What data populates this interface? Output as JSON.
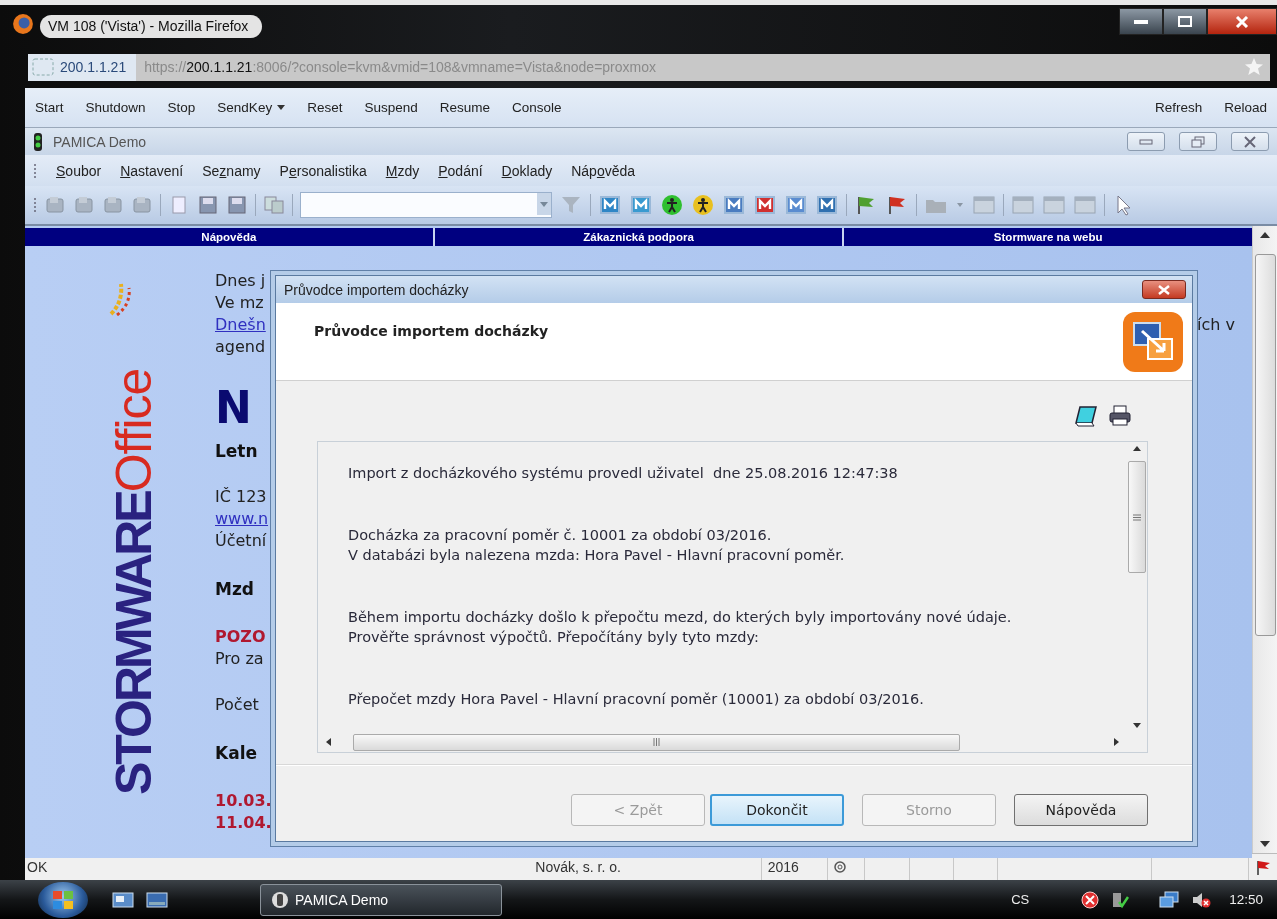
{
  "browser": {
    "title": "VM 108 ('Vista') - Mozilla Firefox",
    "site_identity": "200.1.1.21",
    "url": {
      "scheme": "https://",
      "host": "200.1.1.21",
      "rest": ":8006/?console=kvm&vmid=108&vmname=Vista&node=proxmox"
    }
  },
  "console_toolbar": {
    "left": [
      {
        "label": "Start",
        "has_menu": false
      },
      {
        "label": "Shutdown",
        "has_menu": false
      },
      {
        "label": "Stop",
        "has_menu": false
      },
      {
        "label": "SendKey",
        "has_menu": true
      },
      {
        "label": "Reset",
        "has_menu": false
      },
      {
        "label": "Suspend",
        "has_menu": false
      },
      {
        "label": "Resume",
        "has_menu": false
      },
      {
        "label": "Console",
        "has_menu": false
      }
    ],
    "right": [
      {
        "label": "Refresh",
        "has_menu": false
      },
      {
        "label": "Reload",
        "has_menu": false
      }
    ]
  },
  "app": {
    "title": "PAMICA Demo"
  },
  "menu": [
    {
      "key": "S",
      "rest": "oubor"
    },
    {
      "key": "N",
      "rest": "astavení"
    },
    {
      "lead": "Se",
      "key": "z",
      "rest": "namy"
    },
    {
      "lead": "P",
      "key": "e",
      "rest": "rsonalistika"
    },
    {
      "key": "M",
      "rest": "zdy"
    },
    {
      "key": "P",
      "rest": "odání"
    },
    {
      "key": "D",
      "rest": "oklady"
    },
    {
      "lead": "Náp",
      "key": "o",
      "rest": "věda"
    }
  ],
  "page": {
    "nav_links": [
      "Nápověda",
      "Zákaznická podpora",
      "Stormware na webu"
    ],
    "logo": {
      "brand": "STORMWARE",
      "product": "Office"
    },
    "blocks": [
      {
        "lines": [
          {
            "kind": "text",
            "text": "Dnes j"
          },
          {
            "kind": "text",
            "text": "Ve mz"
          },
          {
            "kind": "link",
            "text": "Dnešn"
          },
          {
            "kind": "text",
            "text": "agend"
          }
        ]
      },
      {
        "lines": [
          {
            "kind": "title",
            "text": "N"
          },
          {
            "kind": "subtitle",
            "text": "Letn"
          }
        ]
      },
      {
        "lines": [
          {
            "kind": "text",
            "text": "IČ 123"
          },
          {
            "kind": "link",
            "text": "www.n"
          },
          {
            "kind": "text",
            "text": "Účetní"
          }
        ]
      },
      {
        "lines": [
          {
            "kind": "heading",
            "text": "Mzd"
          }
        ]
      },
      {
        "lines": [
          {
            "kind": "alert",
            "text": "POZO"
          },
          {
            "kind": "text",
            "text": "Pro za"
          }
        ]
      },
      {
        "lines": [
          {
            "kind": "text",
            "text": "Počet"
          }
        ]
      },
      {
        "lines": [
          {
            "kind": "heading",
            "text": "Kale"
          }
        ]
      },
      {
        "lines": [
          {
            "kind": "date",
            "text": "10.03."
          },
          {
            "kind": "date",
            "text": "11.04."
          }
        ]
      }
    ],
    "side_fragment": "ích v"
  },
  "dialog": {
    "title": "Průvodce importem docházky",
    "header_title": "Průvodce importem docházky",
    "paragraphs": [
      [
        "Import z docházkového systému provedl uživatel  dne 25.08.2016 12:47:38"
      ],
      [
        "Docházka za pracovní poměr č. 10001 za období 03/2016.",
        "V databázi byla nalezena mzda: Hora Pavel - Hlavní pracovní poměr."
      ],
      [
        "Během importu docházky došlo k přepočtu mezd, do kterých byly importovány nové údaje.",
        "Prověřte správnost výpočtů. Přepočítány byly tyto mzdy:"
      ],
      [
        "Přepočet mzdy Hora Pavel - Hlavní pracovní poměr (10001) za období 03/2016."
      ]
    ],
    "buttons": [
      {
        "label": "< Zpět",
        "disabled": true,
        "default": false
      },
      {
        "label": "Dokončit",
        "disabled": false,
        "default": true
      },
      {
        "label": "Storno",
        "disabled": true,
        "default": false
      },
      {
        "label": "Nápověda",
        "disabled": false,
        "default": false
      }
    ]
  },
  "status_bar": {
    "message": "OK",
    "company": "Novák, s. r. o.",
    "year": "2016"
  },
  "taskbar": {
    "tasks": [
      {
        "label": "PAMICA Demo",
        "selected": true
      }
    ],
    "language": "CS",
    "clock": "12:50"
  }
}
